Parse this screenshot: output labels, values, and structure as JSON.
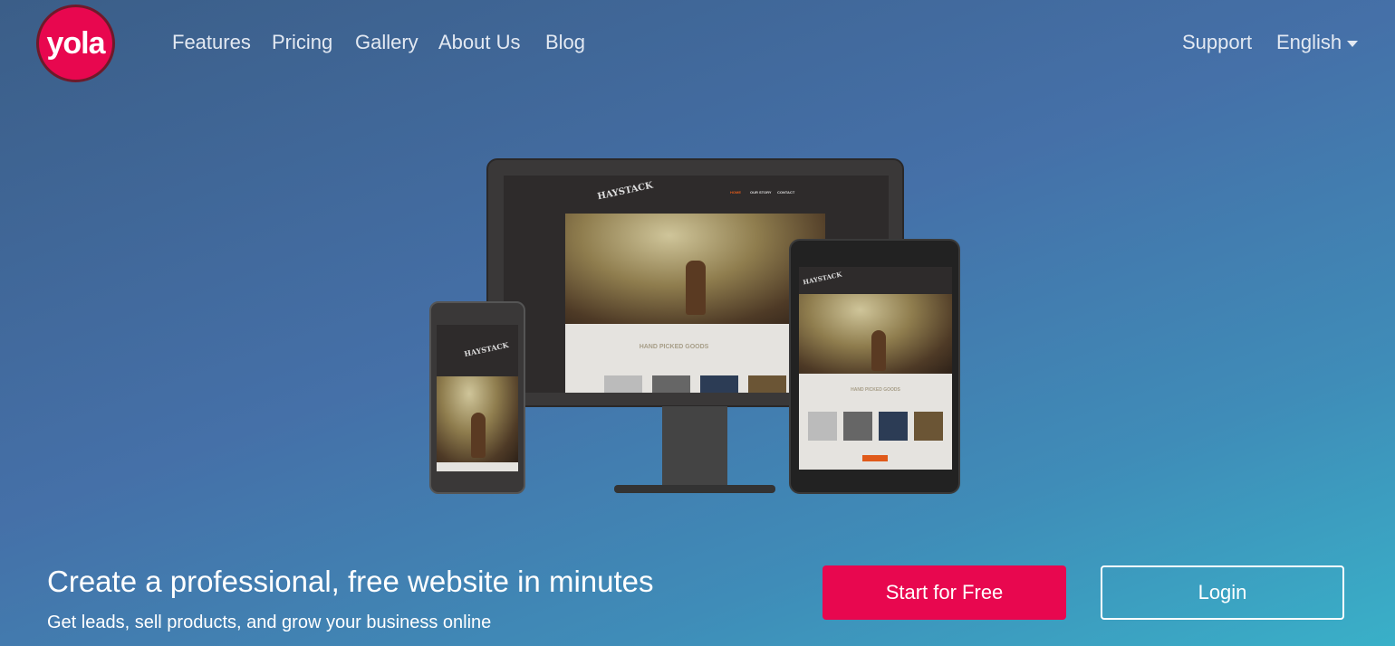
{
  "header": {
    "logo": "yola",
    "nav": [
      "Features",
      "Pricing",
      "Gallery",
      "About Us",
      "Blog"
    ],
    "support": "Support",
    "language": "English"
  },
  "mockup": {
    "brand": "HAYSTACK",
    "nav": [
      "HOME",
      "OUR STORY",
      "CONTACT"
    ],
    "heading": "HAND PICKED GOODS"
  },
  "hero": {
    "title": "Create a professional, free website in minutes",
    "subtitle": "Get leads, sell products, and grow your business online",
    "start_label": "Start for Free",
    "login_label": "Login"
  },
  "colors": {
    "brand": "#e8074f",
    "accent_orange": "#e05a1a"
  }
}
